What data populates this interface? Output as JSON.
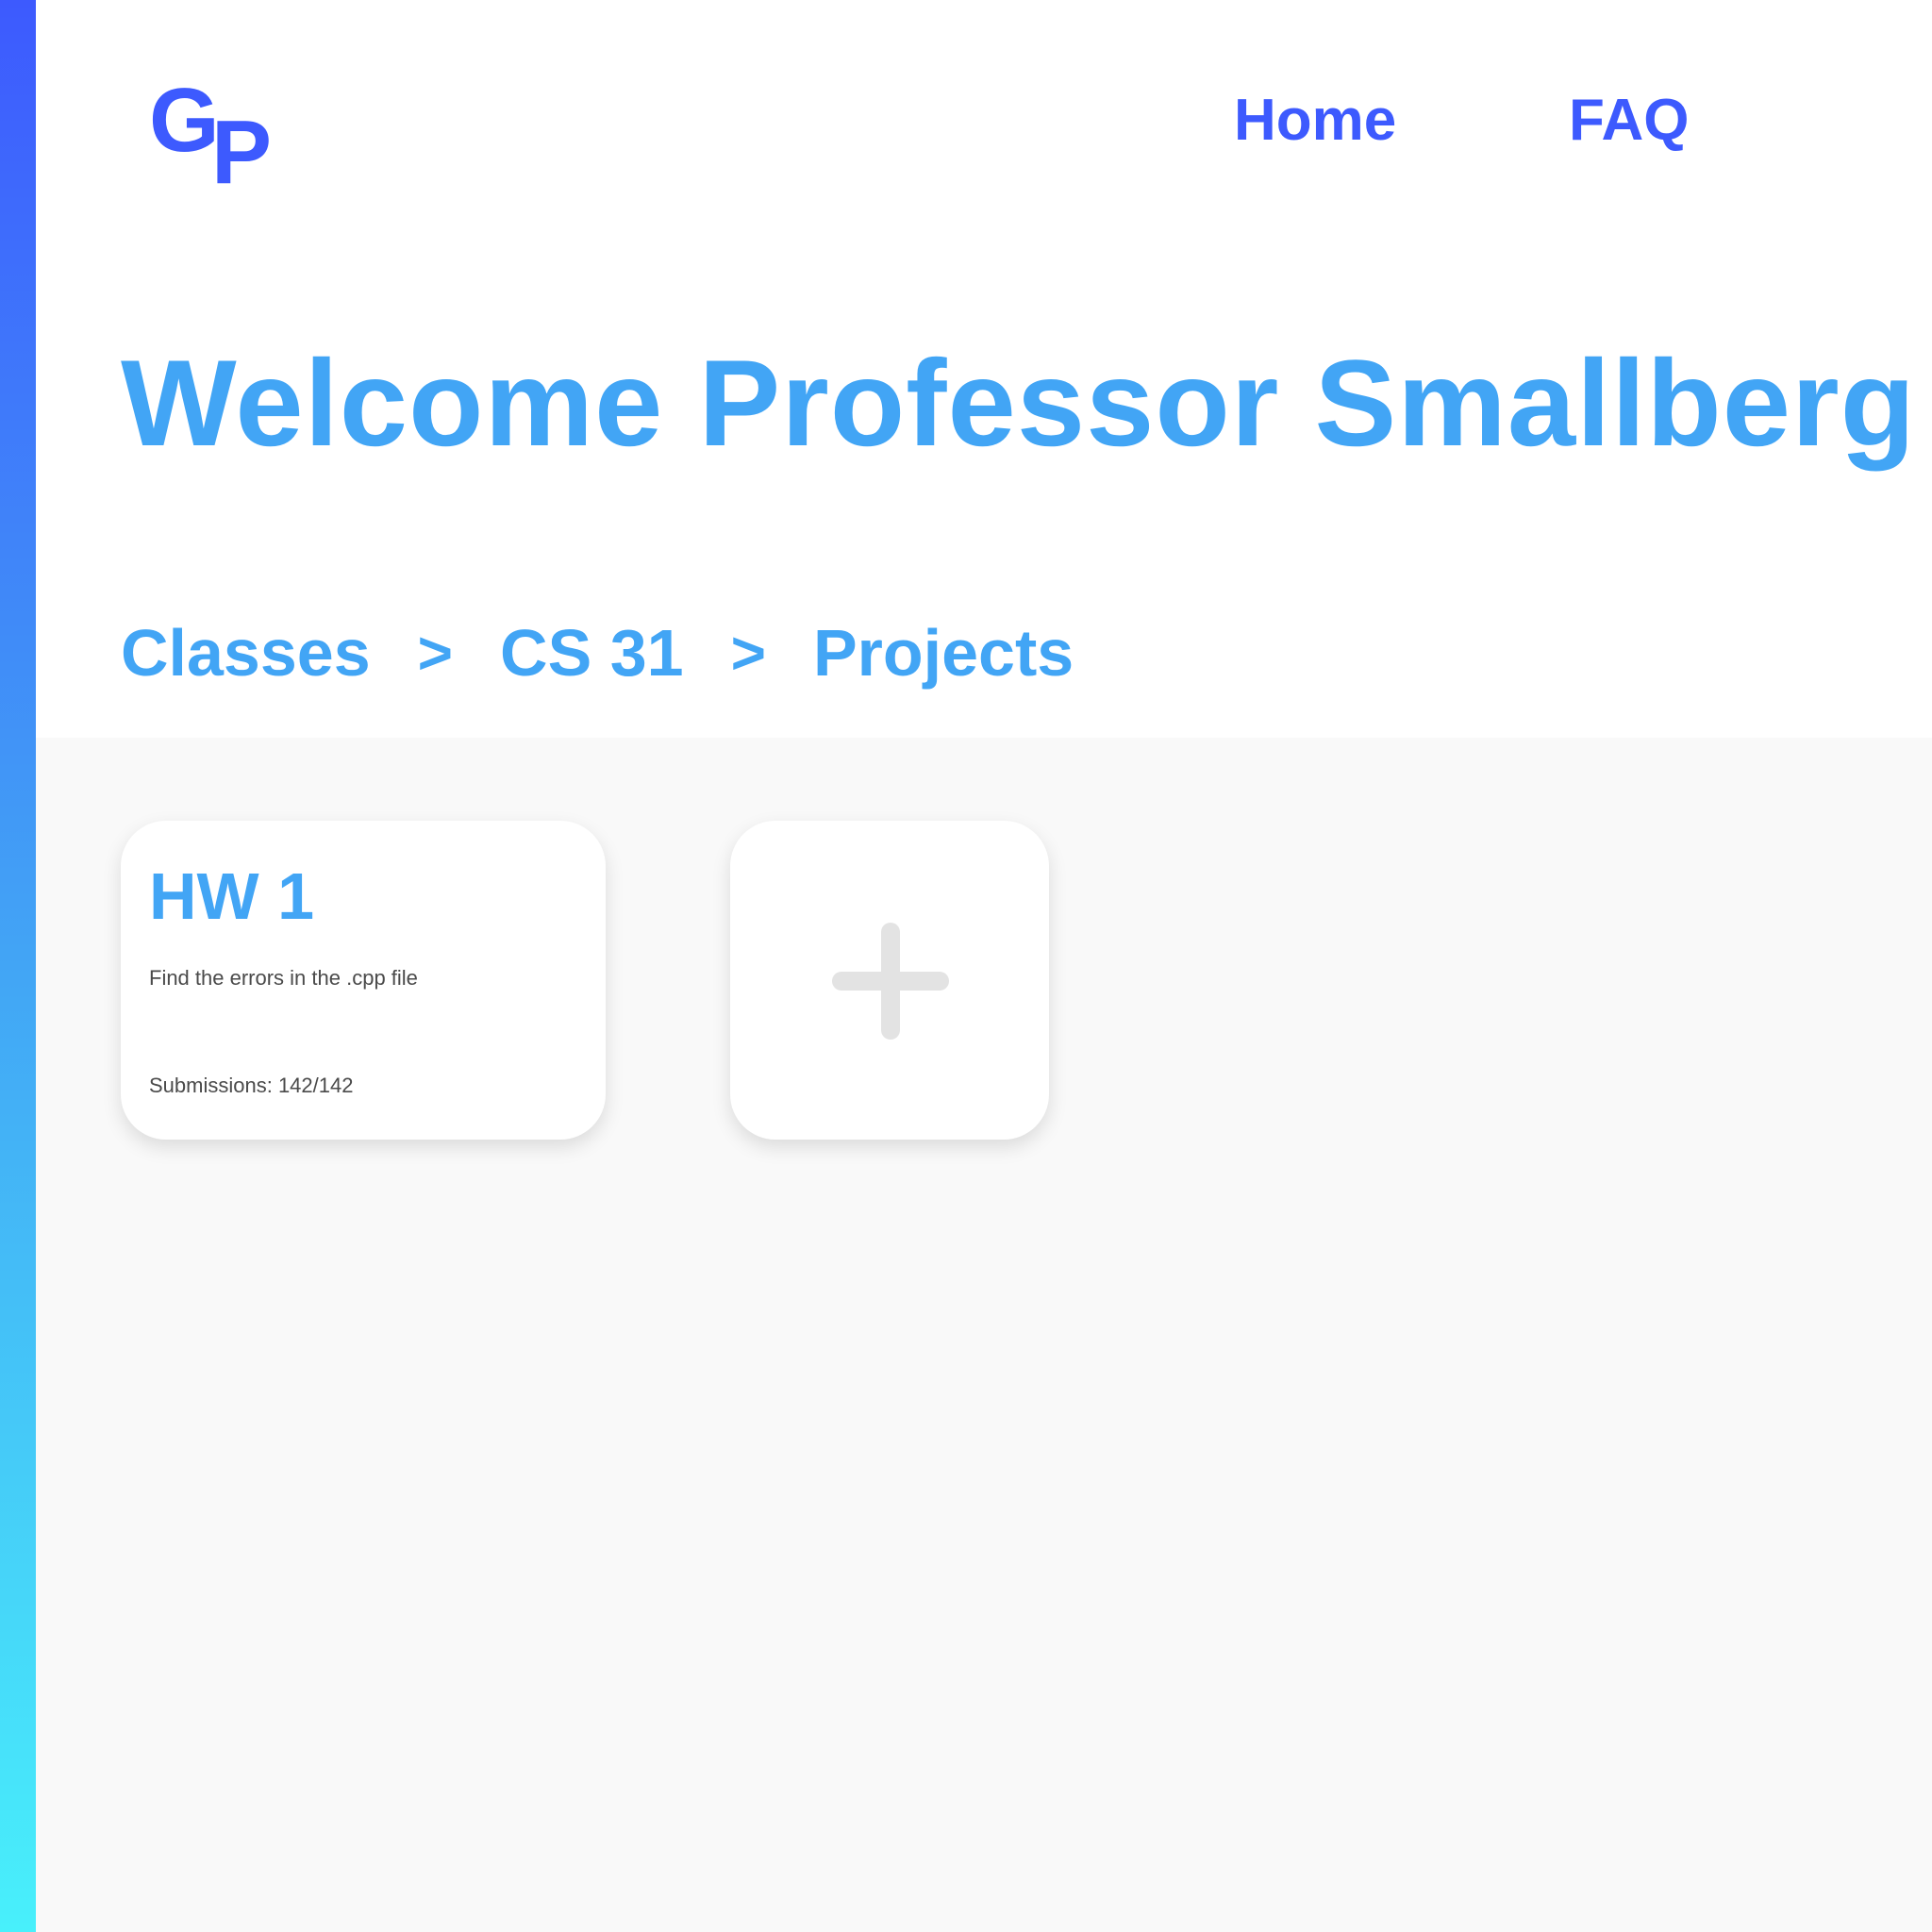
{
  "brand": {
    "logo_g": "G",
    "logo_p": "P",
    "primary_color": "#3d5afe",
    "accent_color": "#42a5f5"
  },
  "nav": {
    "home_label": "Home",
    "faq_label": "FAQ"
  },
  "page_title": "Welcome Professor Smallberg",
  "breadcrumb": {
    "items": [
      "Classes",
      "CS 31",
      "Projects"
    ],
    "separator": ">"
  },
  "projects": [
    {
      "title": "HW 1",
      "description": "Find the errors in the .cpp file",
      "submissions": "Submissions: 142/142"
    }
  ],
  "add_card": {
    "icon": "plus-icon"
  }
}
